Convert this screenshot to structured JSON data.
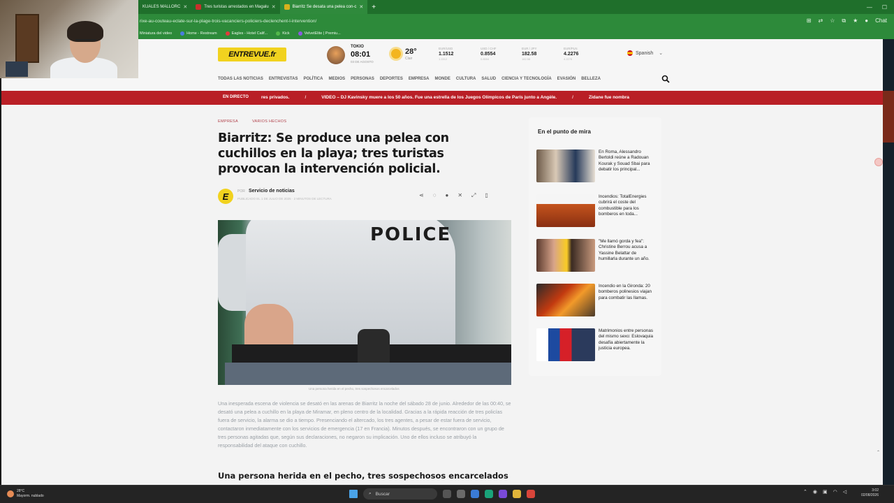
{
  "browser": {
    "tabs": [
      {
        "label": "KUALES MALLORC",
        "active": false
      },
      {
        "label": "Tres turistas arrestados en Magalu",
        "active": false
      },
      {
        "label": "Biarritz Se desata una pelea con-c",
        "active": true
      }
    ],
    "url": "rixe-au-couteau-eclate-sur-la-plage-trois-vacanciers-policiers-declenchent-l-intervention/",
    "bookmarks": [
      "Miniatura del video",
      "Home - Restream",
      "Eagles - Hotel Calif...",
      "Kick",
      "VelvetElite | Premiu..."
    ],
    "profile_label": "Chat"
  },
  "site": {
    "logo": "ENTREVUE.fr",
    "city": "TOKIO",
    "time": "08:01",
    "date": "03 DE AGOSTO",
    "temp": "28°",
    "condition": "Clair",
    "fx": [
      {
        "label": "EUR/USD",
        "value": "1.1512",
        "sub": "1.1512"
      },
      {
        "label": "USD / CHF",
        "value": "0.8554",
        "sub": "0.8554"
      },
      {
        "label": "EUR / JPY",
        "value": "182.58",
        "sub": "182.58"
      },
      {
        "label": "EUR/PLN",
        "value": "4.2276",
        "sub": "4.2276"
      }
    ],
    "language": "Spanish",
    "nav": [
      "TODAS LAS NOTICIAS",
      "ENTREVISTAS",
      "POLÍTICA",
      "MEDIOS",
      "PERSONAS",
      "DEPORTES",
      "EMPRESA",
      "MONDE",
      "CULTURA",
      "SALUD",
      "CIENCIA Y TECNOLOGÍA",
      "EVASIÓN",
      "BELLEZA"
    ],
    "ticker": {
      "live": "EN DIRECTO",
      "items": [
        "res privados.",
        "VIDEO – DJ Kavinsky muere a los 50 años. Fue una estrella de los Juegos Olímpicos de París junto a Angèle.",
        "Zidane fue nombra"
      ]
    }
  },
  "article": {
    "categories": [
      "EMPRESA",
      "VARIOS HECHOS"
    ],
    "title": "Biarritz: Se produce una pelea con cuchillos en la playa; tres turistas provocan la intervención policial.",
    "byline_pre": "POR",
    "author": "Servicio de noticias",
    "meta": "PUBLICADO EL 1 DE JULIO DE 2025  ·  2 MINUTOS DE LECTURA",
    "hero_text": "POLICE",
    "caption": "Una persona herida en el pecho, tres sospechosos encarcelados",
    "body": "Una inesperada escena de violencia se desató en las arenas de Biarritz la noche del sábado 28 de junio. Alrededor de las 00:40, se desató una pelea a cuchillo en la playa de Miramar, en pleno centro de la localidad. Gracias a la rápida reacción de tres policías fuera de servicio, la alarma se dio a tiempo. Presenciando el altercado, los tres agentes, a pesar de estar fuera de servicio, contactaron inmediatamente con los servicios de emergencia (17 en Francia). Minutos después, se encontraron con un grupo de tres personas agitadas que, según sus declaraciones, no negaron su implicación. Uno de ellos incluso se atribuyó la responsabilidad del ataque con cuchillo.",
    "subhead": "Una persona herida en el pecho, tres sospechosos encarcelados"
  },
  "sidebar": {
    "title": "En el punto de mira",
    "items": [
      {
        "text": "En Roma, Alessandro Bertoldi reúne a Radouan Kourak y Souad Sbai para debatir los principal..."
      },
      {
        "text": "Incendios: TotalEnergies cubrirá el coste del combustible para los bomberos en toda..."
      },
      {
        "text": "\"Me llamó gorda y fea\": Christine Berrou acusa a Yassine Belattar de humillarla durante un año."
      },
      {
        "text": "Incendio en la Gironda: 20 bomberos polinesios viajan para combatir las llamas."
      },
      {
        "text": "Matrimonios entre personas del mismo sexo: Eslovaquia desafía abiertamente la justicia europea."
      }
    ]
  },
  "taskbar": {
    "weather_temp": "28°C",
    "weather_desc": "Mayorm. nublado",
    "search_placeholder": "Buscar",
    "time": "3:02",
    "date": "02/08/2026"
  },
  "colors": {
    "brand_yellow": "#f1d21f",
    "ticker_red": "#b91f26",
    "chrome_green": "#2d8a3a"
  }
}
